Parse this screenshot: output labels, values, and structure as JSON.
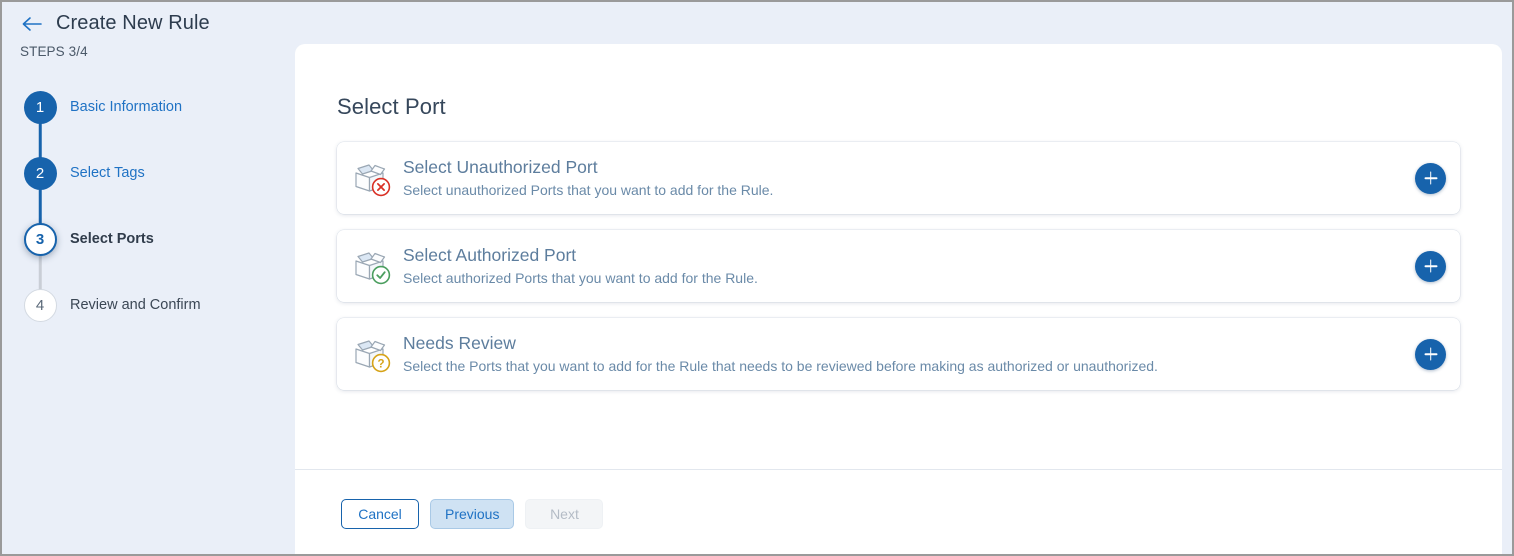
{
  "header": {
    "back_icon": "back-arrow-icon",
    "title": "Create New Rule",
    "steps_label": "STEPS 3/4"
  },
  "stepper": {
    "steps": [
      {
        "number": "1",
        "label": "Basic Information",
        "state": "done"
      },
      {
        "number": "2",
        "label": "Select Tags",
        "state": "done"
      },
      {
        "number": "3",
        "label": "Select Ports",
        "state": "current"
      },
      {
        "number": "4",
        "label": "Review and Confirm",
        "state": "todo"
      }
    ]
  },
  "main": {
    "section_title": "Select Port",
    "cards": [
      {
        "icon": "open-box-rejected-icon",
        "title": "Select Unauthorized Port",
        "description": "Select unauthorized Ports that you want to add for the Rule.",
        "add_label": "add-icon"
      },
      {
        "icon": "open-box-approved-icon",
        "title": "Select Authorized Port",
        "description": "Select authorized Ports that you want to add for the Rule.",
        "add_label": "add-icon"
      },
      {
        "icon": "open-box-question-icon",
        "title": "Needs Review",
        "description": "Select the Ports that you want to add for the Rule that needs to be reviewed before making as authorized or unauthorized.",
        "add_label": "add-icon"
      }
    ]
  },
  "footer": {
    "cancel_label": "Cancel",
    "previous_label": "Previous",
    "next_label": "Next"
  },
  "colors": {
    "accent_blue": "#1763ac",
    "link_blue": "#1f72c4",
    "page_bg": "#eaeff8",
    "panel_bg": "#ffffff",
    "card_title": "#5d7d9d",
    "reject_red": "#d93025",
    "approve_green": "#4b9e5f",
    "review_amber": "#d6a318"
  }
}
